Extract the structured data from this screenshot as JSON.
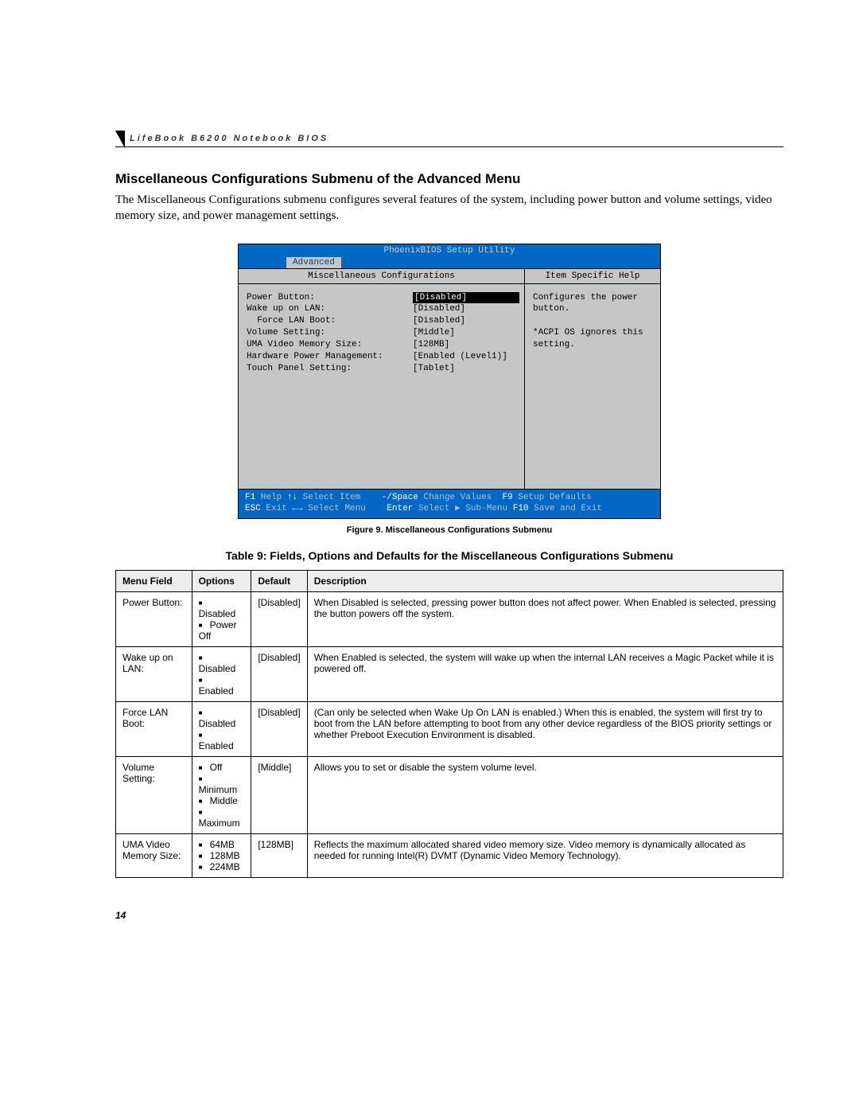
{
  "header": "LifeBook B6200 Notebook BIOS",
  "section_title": "Miscellaneous Configurations Submenu of the Advanced Menu",
  "intro": "The Miscellaneous Configurations submenu configures several features of the system, including power button and volume settings, video memory size, and power management settings.",
  "bios": {
    "title": "PhoenixBIOS Setup Utility",
    "active_tab": "Advanced",
    "left_heading": "Miscellaneous Configurations",
    "right_heading": "Item Specific Help",
    "items": [
      {
        "label": "Power Button:",
        "value": "[Disabled]",
        "selected": true,
        "indent": 0
      },
      {
        "label": "Wake up on LAN:",
        "value": "[Disabled]",
        "selected": false,
        "indent": 0
      },
      {
        "label": "Force LAN Boot:",
        "value": "[Disabled]",
        "selected": false,
        "indent": 1
      },
      {
        "label": "Volume Setting:",
        "value": "[Middle]",
        "selected": false,
        "indent": 0
      },
      {
        "label": "UMA Video Memory Size:",
        "value": "[128MB]",
        "selected": false,
        "indent": 0
      },
      {
        "label": "Hardware Power Management:",
        "value": "[Enabled (Level1)]",
        "selected": false,
        "indent": 0
      },
      {
        "label": "Touch Panel Setting:",
        "value": "[Tablet]",
        "selected": false,
        "indent": 0
      }
    ],
    "help_lines": [
      "Configures the power",
      "button.",
      "",
      "*ACPI OS ignores this",
      "setting."
    ],
    "footer": {
      "row1": [
        {
          "k": "F1",
          "t": " Help"
        },
        {
          "k": "↑↓",
          "t": " Select Item"
        },
        {
          "k": "-/Space",
          "t": " Change Values"
        },
        {
          "k": "F9",
          "t": " Setup Defaults"
        }
      ],
      "row2": [
        {
          "k": "ESC",
          "t": " Exit"
        },
        {
          "k": "←→",
          "t": " Select Menu"
        },
        {
          "k": "Enter",
          "t": " Select ▶ Sub-Menu"
        },
        {
          "k": "F10",
          "t": " Save and Exit"
        }
      ]
    }
  },
  "figure_caption": "Figure 9.  Miscellaneous Configurations Submenu",
  "table_title": "Table 9: Fields, Options and Defaults for the Miscellaneous Configurations Submenu",
  "table": {
    "headers": [
      "Menu Field",
      "Options",
      "Default",
      "Description"
    ],
    "rows": [
      {
        "field": "Power Button:",
        "options": [
          "Disabled",
          "Power Off"
        ],
        "default": "[Disabled]",
        "desc": "When Disabled is selected, pressing power button does not affect power. When Enabled is selected, pressing the button powers off the system."
      },
      {
        "field": "Wake up on LAN:",
        "options": [
          "Disabled",
          "Enabled"
        ],
        "default": "[Disabled]",
        "desc": "When Enabled is selected, the system will wake up when the internal LAN receives a Magic Packet while it is powered off."
      },
      {
        "field": "Force LAN Boot:",
        "options": [
          "Disabled",
          "Enabled"
        ],
        "default": "[Disabled]",
        "desc": "(Can only be selected when Wake Up On LAN is enabled.) When this is enabled, the system will first try to boot from the LAN before attempting to boot from any other device regardless of the BIOS priority settings or whether Preboot Execution Environment is disabled."
      },
      {
        "field": "Volume Setting:",
        "options": [
          "Off",
          "Minimum",
          "Middle",
          "Maximum"
        ],
        "default": "[Middle]",
        "desc": "Allows you to set or disable the system volume level."
      },
      {
        "field": "UMA Video Memory Size:",
        "options": [
          "64MB",
          "128MB",
          "224MB"
        ],
        "default": "[128MB]",
        "desc": "Reflects the maximum allocated shared video memory size. Video memory is dynamically allocated as needed for running Intel(R) DVMT (Dynamic Video Memory Technology)."
      }
    ]
  },
  "page_number": "14"
}
